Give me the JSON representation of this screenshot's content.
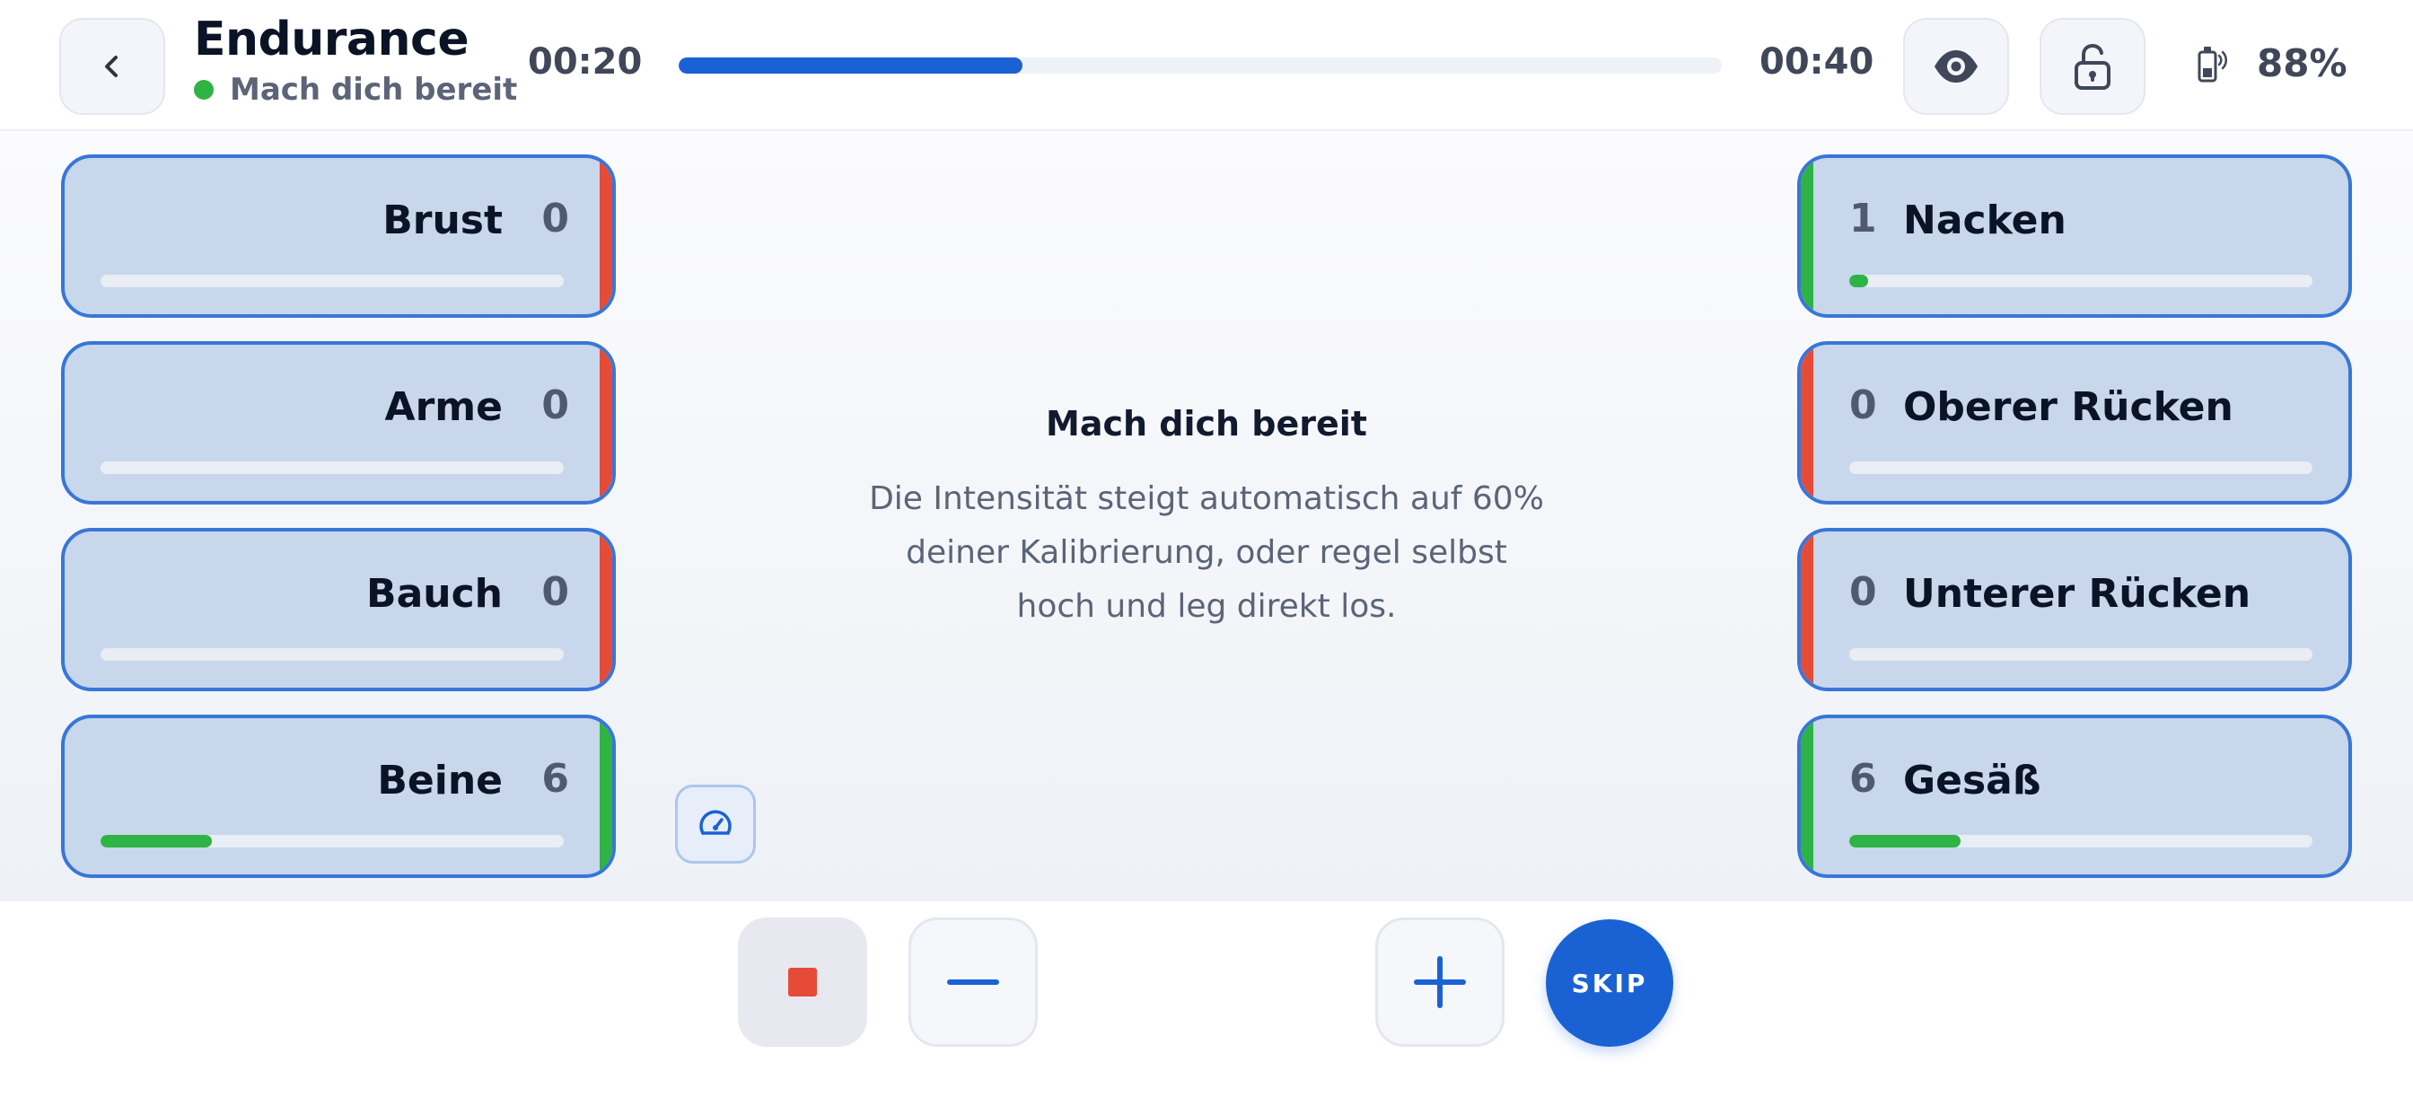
{
  "header": {
    "title": "Endurance",
    "status": "Mach dich bereit",
    "status_color": "#2fb344",
    "elapsed": "00:20",
    "total": "00:40",
    "progress": 0.33,
    "battery": "88%",
    "icons": {
      "back": "chevron-left-icon",
      "view": "eye-icon",
      "lock": "unlock-icon",
      "battery": "device-battery-icon"
    }
  },
  "zones": {
    "left": [
      {
        "label": "Brust",
        "value": "0",
        "fill": 0.0,
        "indicator": "#e64b37"
      },
      {
        "label": "Arme",
        "value": "0",
        "fill": 0.0,
        "indicator": "#e64b37"
      },
      {
        "label": "Bauch",
        "value": "0",
        "fill": 0.0,
        "indicator": "#e64b37"
      },
      {
        "label": "Beine",
        "value": "6",
        "fill": 0.24,
        "indicator": "#2fb344"
      }
    ],
    "right": [
      {
        "label": "Nacken",
        "value": "1",
        "fill": 0.04,
        "indicator": "#2fb344"
      },
      {
        "label": "Oberer Rücken",
        "value": "0",
        "fill": 0.0,
        "indicator": "#e64b37"
      },
      {
        "label": "Unterer Rücken",
        "value": "0",
        "fill": 0.0,
        "indicator": "#e64b37"
      },
      {
        "label": "Gesäß",
        "value": "6",
        "fill": 0.24,
        "indicator": "#2fb344"
      }
    ]
  },
  "info": {
    "title": "Mach dich bereit",
    "line1": "Die Intensität steigt automatisch auf 60%",
    "line2": "deiner Kalibrierung, oder regel selbst",
    "line3": "hoch und leg direkt los."
  },
  "controls": {
    "skip_label": "SKIP",
    "icons": {
      "stop": "stop-icon",
      "minus": "minus-icon",
      "plus": "plus-icon",
      "gauge": "gauge-icon"
    }
  },
  "colors": {
    "accent": "#1a62d4",
    "zone_border": "#3876d8",
    "zone_bg": "#c8d7eb",
    "green": "#2fb344",
    "red": "#e64b37"
  }
}
